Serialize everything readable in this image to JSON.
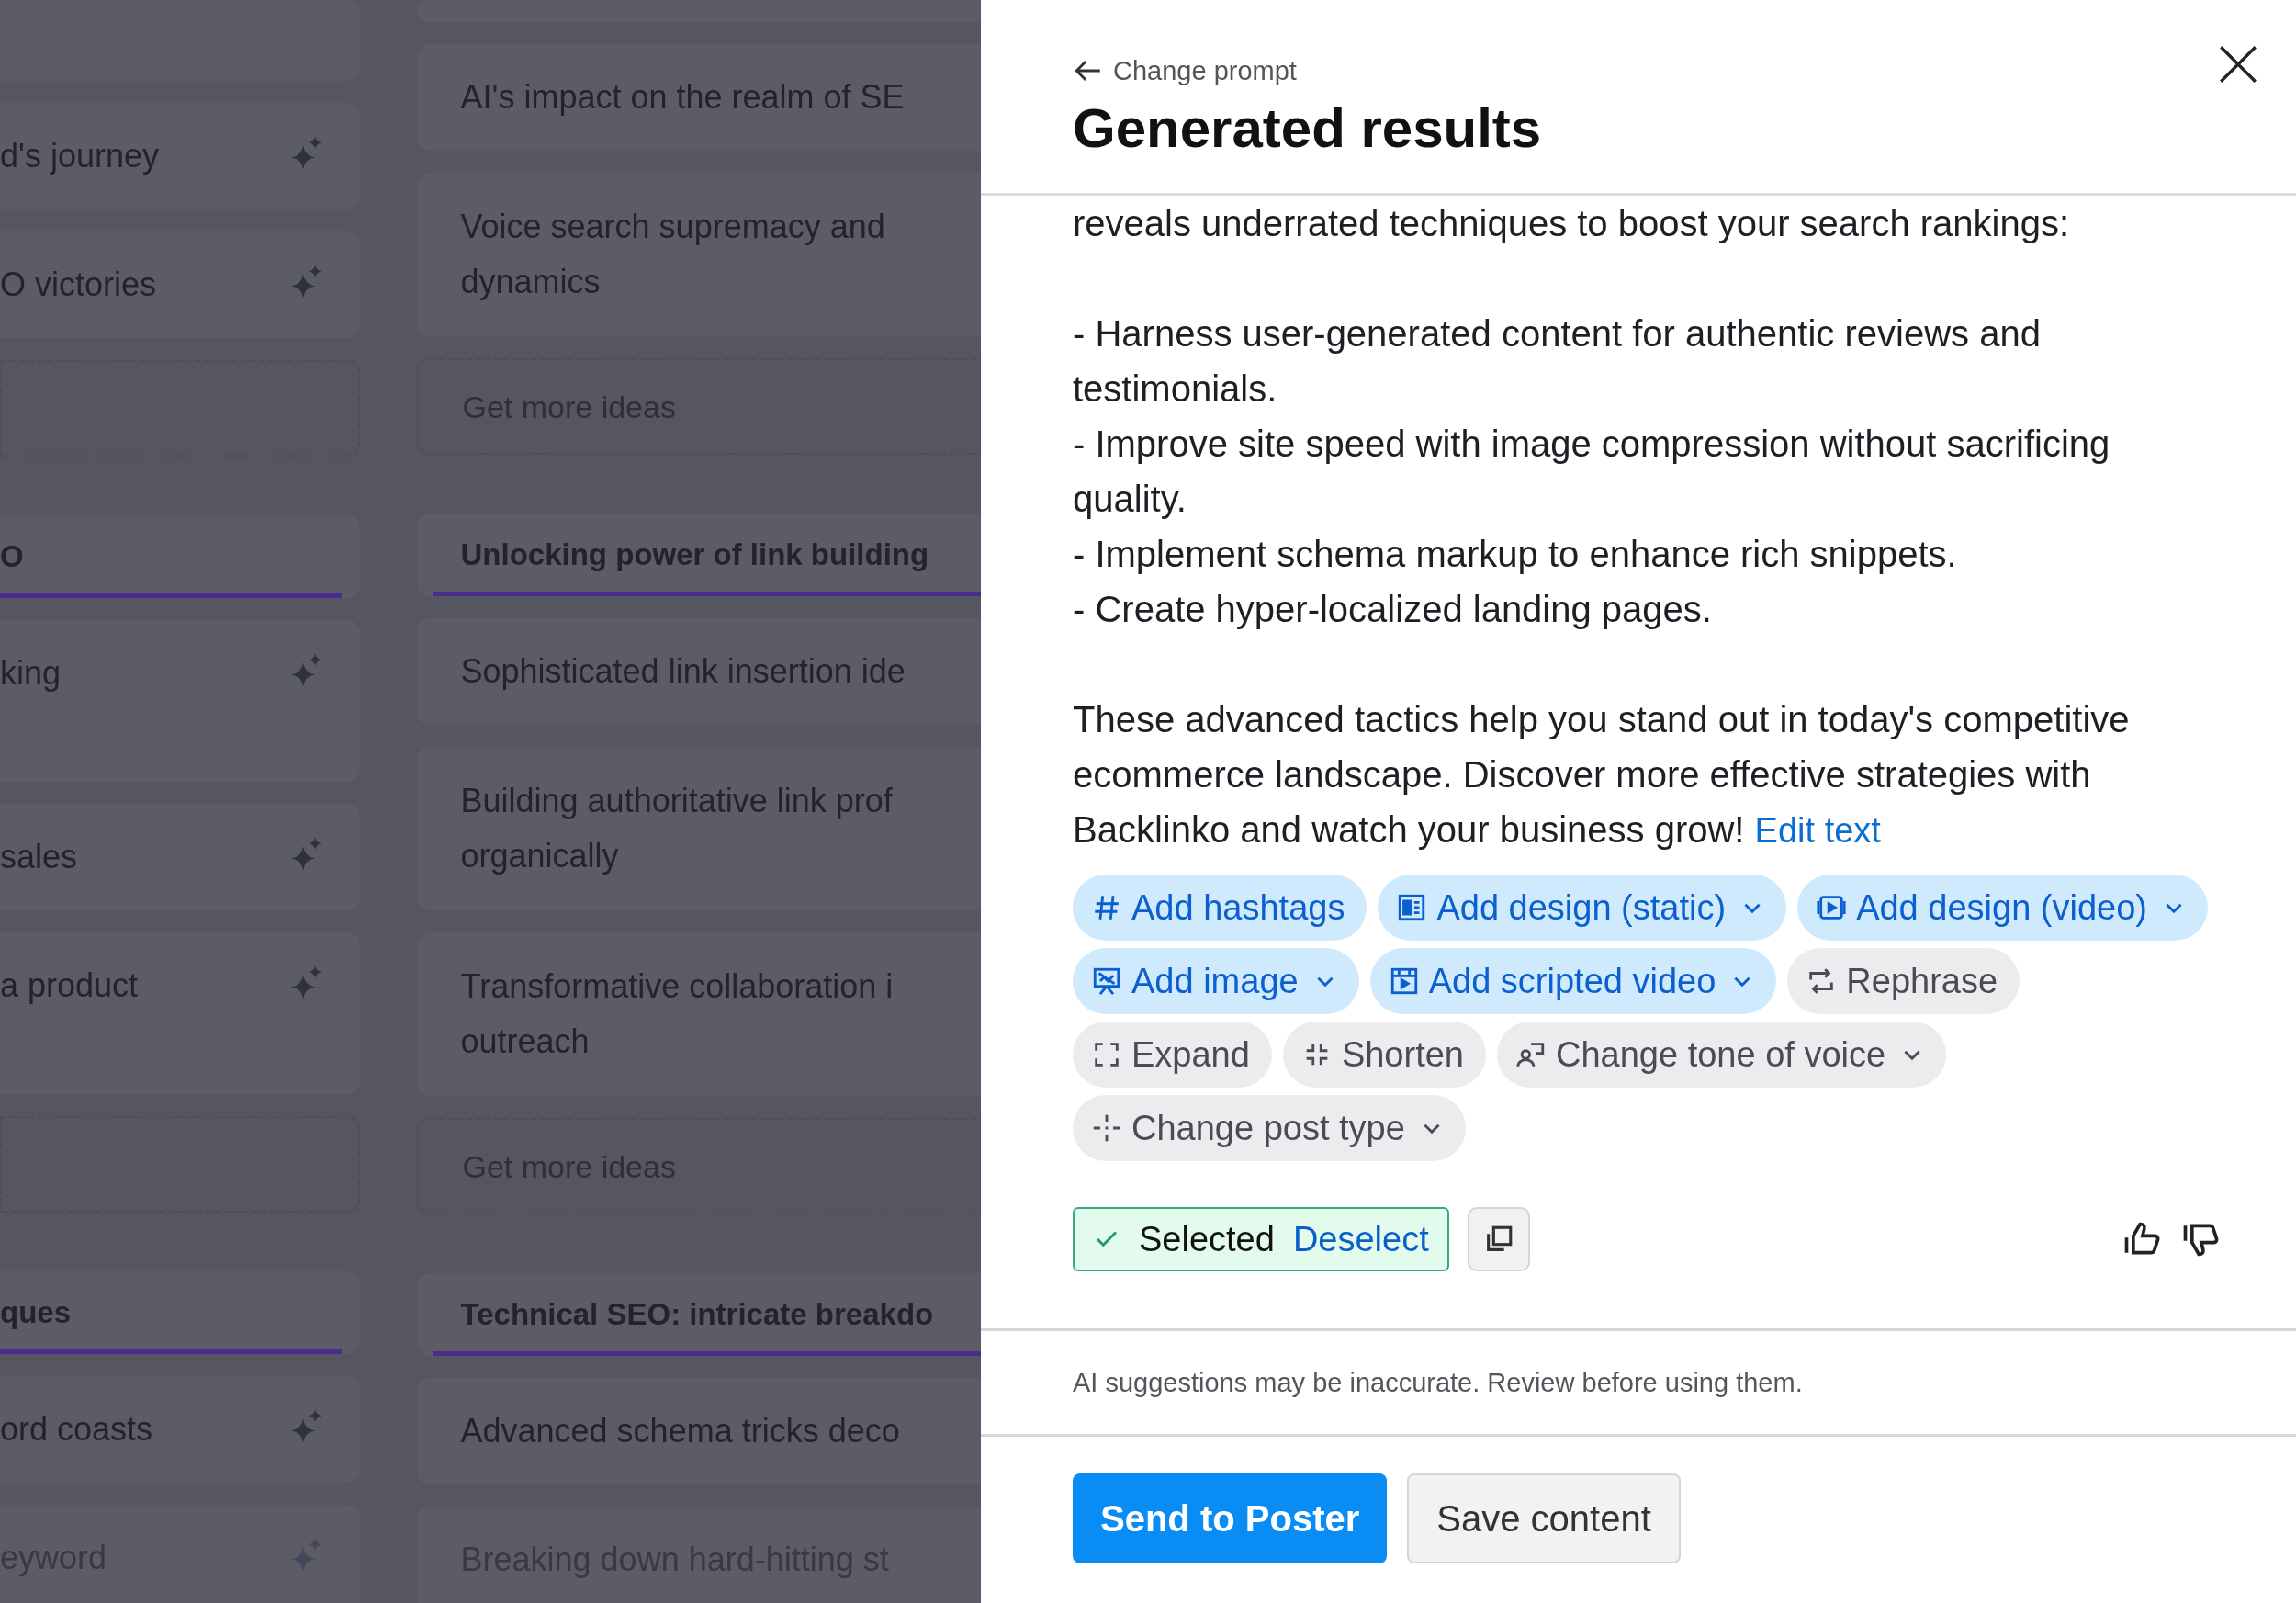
{
  "board": {
    "left_column": [
      {
        "kind": "stub"
      },
      {
        "kind": "card",
        "text": "d's journey",
        "faded": false
      },
      {
        "kind": "card",
        "text": "O victories",
        "faded": false
      },
      {
        "kind": "more"
      },
      {
        "kind": "header",
        "text": "O"
      },
      {
        "kind": "tall",
        "text": "king",
        "faded": false
      },
      {
        "kind": "card",
        "text": "sales",
        "faded": false
      },
      {
        "kind": "tall",
        "text": "a product",
        "faded": false
      },
      {
        "kind": "more"
      },
      {
        "kind": "header",
        "text": "ques"
      },
      {
        "kind": "card",
        "text": "ord coasts",
        "faded": false
      },
      {
        "kind": "card",
        "text": "eyword",
        "faded": true
      }
    ],
    "right_column": [
      {
        "kind": "stub"
      },
      {
        "kind": "card",
        "lines": [
          "AI's impact on the realm of SE"
        ],
        "faded": false
      },
      {
        "kind": "card",
        "lines": [
          "Voice search supremacy and",
          "dynamics"
        ],
        "faded": false
      },
      {
        "kind": "more",
        "text": "Get more ideas"
      },
      {
        "kind": "header",
        "text": "Unlocking power of link building"
      },
      {
        "kind": "card",
        "lines": [
          "Sophisticated link insertion ide"
        ],
        "faded": false
      },
      {
        "kind": "card",
        "lines": [
          "Building authoritative link prof",
          "organically"
        ],
        "faded": false
      },
      {
        "kind": "card",
        "lines": [
          "Transformative collaboration i",
          "outreach"
        ],
        "faded": false
      },
      {
        "kind": "more",
        "text": "Get more ideas"
      },
      {
        "kind": "header",
        "text": "Technical SEO: intricate breakdo"
      },
      {
        "kind": "card",
        "lines": [
          "Advanced schema tricks deco"
        ],
        "faded": false
      },
      {
        "kind": "card",
        "lines": [
          "Breaking down hard-hitting st"
        ],
        "faded": true
      }
    ]
  },
  "panel": {
    "back_link": "Change prompt",
    "title": "Generated results",
    "body": {
      "intro": "reveals underrated techniques to boost your search rankings:",
      "bullets": [
        "- Harness user-generated content for authentic reviews and testimonials.",
        "- Improve site speed with image compression without sacrificing quality.",
        "- Implement schema markup to enhance rich snippets.",
        "- Create hyper-localized landing pages."
      ],
      "closing": "These advanced tactics help you stand out in today's competitive ecommerce landscape. Discover more effective strategies with Backlinko and watch your business grow!",
      "edit_link": "Edit text"
    },
    "actions": [
      {
        "label": "Add hashtags",
        "kind": "primary",
        "dropdown": false
      },
      {
        "label": "Add design (static)",
        "kind": "primary",
        "dropdown": true
      },
      {
        "label": "Add design (video)",
        "kind": "primary",
        "dropdown": true
      },
      {
        "label": "Add image",
        "kind": "primary",
        "dropdown": true
      },
      {
        "label": "Add scripted video",
        "kind": "primary",
        "dropdown": true
      },
      {
        "label": "Rephrase",
        "kind": "secondary",
        "dropdown": false
      },
      {
        "label": "Expand",
        "kind": "secondary",
        "dropdown": false
      },
      {
        "label": "Shorten",
        "kind": "secondary",
        "dropdown": false
      },
      {
        "label": "Change tone of voice",
        "kind": "secondary",
        "dropdown": true
      },
      {
        "label": "Change post type",
        "kind": "secondary",
        "dropdown": true
      }
    ],
    "selection": {
      "selected": true,
      "label": "Selected",
      "toggle": "Deselect"
    },
    "disclaimer": "AI suggestions may be inaccurate. Review before using them.",
    "buttons": [
      {
        "label": "Send to Poster",
        "kind": "primary"
      },
      {
        "label": "Save content",
        "kind": "secondary"
      }
    ]
  }
}
